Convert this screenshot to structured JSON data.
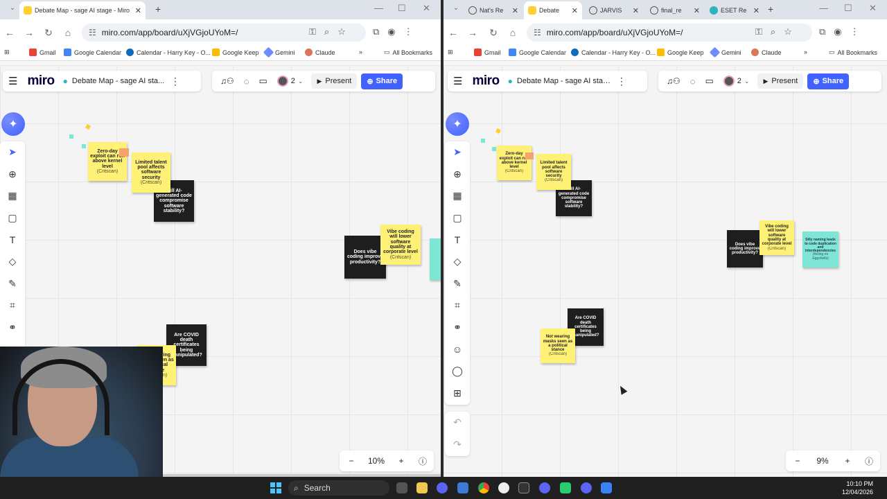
{
  "left_window": {
    "tabs": [
      {
        "title": "Debate Map - sage AI stage - Miro",
        "active": true,
        "icon": "miro-icon"
      }
    ],
    "url": "miro.com/app/board/uXjVGjoUYoM=/",
    "bookmarks": [
      "Gmail",
      "Google Calendar",
      "Calendar - Harry Key - O...",
      "Google Keep",
      "Gemini",
      "Claude"
    ],
    "all_bookmarks": "All Bookmarks",
    "board_title": "Debate Map - sage AI sta...",
    "zoom": "10%"
  },
  "right_window": {
    "tabs": [
      {
        "title": "Nat's Re",
        "active": false,
        "icon": "globe-icon"
      },
      {
        "title": "Debate",
        "active": true,
        "icon": "miro-icon"
      },
      {
        "title": "JARVIS",
        "active": false,
        "icon": "globe-icon"
      },
      {
        "title": "final_re",
        "active": false,
        "icon": "globe-icon"
      },
      {
        "title": "ESET Re",
        "active": false,
        "icon": "cyan-icon"
      }
    ],
    "url": "miro.com/app/board/uXjVGjoUYoM=/",
    "bookmarks": [
      "Gmail",
      "Google Calendar",
      "Calendar - Harry Key - O...",
      "Google Keep",
      "Gemini",
      "Claude"
    ],
    "all_bookmarks": "All Bookmarks",
    "board_title": "Debate Map - sage AI stage",
    "zoom": "9%"
  },
  "miro": {
    "logo": "miro",
    "present_label": "Present",
    "share_label": "Share",
    "collaborators_count": "2"
  },
  "stickies": {
    "zero_day": {
      "text": "Zero-day exploit can run above kernel level",
      "source": "(Critscan)"
    },
    "talent": {
      "text": "Limited talent pool affects software security",
      "source": "(Critscan)"
    },
    "ai_code": {
      "text": "Will AI-generated code compromise software stability?"
    },
    "vibe_q": {
      "text": "Does vibe coding improve productivity?"
    },
    "vibe_lower": {
      "text": "Vibe coding will lower software quality at corporate level",
      "source": "(Critscan)"
    },
    "naming": {
      "text": "Silly naming leads to code duplication and interdependencies",
      "source": "(Acting on Eggshells)"
    },
    "covid_q": {
      "text": "Are COVID death certificates being manipulated?"
    },
    "masks": {
      "text": "Not wearing masks seen as a political stance",
      "source": "(Critscan)"
    }
  },
  "taskbar": {
    "search_label": "Search",
    "time": "10:10 PM",
    "date": "12/04/2026"
  },
  "colors": {
    "miro_blue": "#4262ff",
    "sticky_yellow": "#fff176",
    "sticky_black": "#1e1e1e",
    "sticky_teal": "#7fe5d5"
  }
}
